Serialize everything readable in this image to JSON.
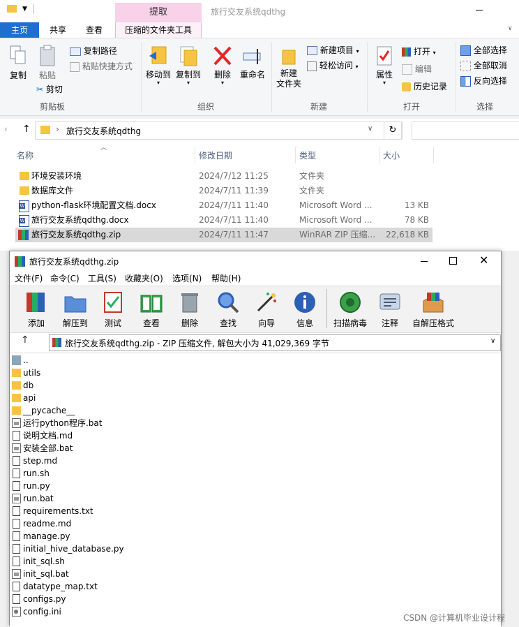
{
  "explorer": {
    "title": "旅行交友系统qdthg",
    "context_tab_top": "提取",
    "tabs": [
      "主页",
      "共享",
      "查看",
      "压缩的文件夹工具"
    ],
    "ribbon": {
      "clipboard": {
        "copy": "复制",
        "paste": "粘贴",
        "copy_path": "复制路径",
        "paste_shortcut": "粘贴快捷方式",
        "cut": "剪切",
        "label": "剪贴板"
      },
      "organize": {
        "move_to": "移动到",
        "copy_to": "复制到",
        "delete": "删除",
        "rename": "重命名",
        "label": "组织"
      },
      "new": {
        "new_folder_line1": "新建",
        "new_folder_line2": "文件夹",
        "new_item": "新建项目",
        "easy_access": "轻松访问",
        "label": "新建"
      },
      "open": {
        "properties": "属性",
        "open": "打开",
        "edit": "编辑",
        "history": "历史记录",
        "label": "打开"
      },
      "select": {
        "select_all": "全部选择",
        "select_none": "全部取消",
        "invert": "反向选择",
        "label": "选择"
      }
    },
    "address": "旅行交友系统qdthg",
    "columns": [
      "名称",
      "修改日期",
      "类型",
      "大小"
    ],
    "files": [
      {
        "name": "环境安装环境",
        "date": "2024/7/12 11:25",
        "type": "文件夹",
        "size": "",
        "icon": "folder-icon"
      },
      {
        "name": "数据库文件",
        "date": "2024/7/11 11:39",
        "type": "文件夹",
        "size": "",
        "icon": "folder-icon"
      },
      {
        "name": "python-flask环境配置文档.docx",
        "date": "2024/7/11 11:40",
        "type": "Microsoft Word ...",
        "size": "13 KB",
        "icon": "word-icon"
      },
      {
        "name": "旅行交友系统qdthg.docx",
        "date": "2024/7/11 11:40",
        "type": "Microsoft Word ...",
        "size": "78 KB",
        "icon": "word-icon"
      },
      {
        "name": "旅行交友系统qdthg.zip",
        "date": "2024/7/11 11:47",
        "type": "WinRAR ZIP 压缩...",
        "size": "22,618 KB",
        "icon": "winrar-icon"
      }
    ]
  },
  "winrar": {
    "title": "旅行交友系统qdthg.zip",
    "menu": [
      "文件(F)",
      "命令(C)",
      "工具(S)",
      "收藏夹(O)",
      "选项(N)",
      "帮助(H)"
    ],
    "toolbar": [
      "添加",
      "解压到",
      "测试",
      "查看",
      "删除",
      "查找",
      "向导",
      "信息",
      "扫描病毒",
      "注释",
      "自解压格式"
    ],
    "path": "旅行交友系统qdthg.zip - ZIP 压缩文件, 解包大小为 41,029,369 字节",
    "items": [
      {
        "name": "..",
        "icon": "parent-folder-icon"
      },
      {
        "name": "utils",
        "icon": "folder-icon"
      },
      {
        "name": "db",
        "icon": "folder-icon"
      },
      {
        "name": "api",
        "icon": "folder-icon"
      },
      {
        "name": "__pycache__",
        "icon": "folder-icon"
      },
      {
        "name": "运行python程序.bat",
        "icon": "bat-icon"
      },
      {
        "name": "说明文档.md",
        "icon": "file-icon"
      },
      {
        "name": "安装全部.bat",
        "icon": "bat-icon"
      },
      {
        "name": "step.md",
        "icon": "file-icon"
      },
      {
        "name": "run.sh",
        "icon": "file-icon"
      },
      {
        "name": "run.py",
        "icon": "file-icon"
      },
      {
        "name": "run.bat",
        "icon": "bat-icon"
      },
      {
        "name": "requirements.txt",
        "icon": "file-icon"
      },
      {
        "name": "readme.md",
        "icon": "file-icon"
      },
      {
        "name": "manage.py",
        "icon": "file-icon"
      },
      {
        "name": "initial_hive_database.py",
        "icon": "file-icon"
      },
      {
        "name": "init_sql.sh",
        "icon": "file-icon"
      },
      {
        "name": "init_sql.bat",
        "icon": "bat-icon"
      },
      {
        "name": "datatype_map.txt",
        "icon": "file-icon"
      },
      {
        "name": "configs.py",
        "icon": "file-icon"
      },
      {
        "name": "config.ini",
        "icon": "ini-icon"
      }
    ]
  },
  "watermark": "CSDN @计算机毕业设计程",
  "colors": {
    "accent": "#1f6fd1",
    "context_tab": "#f7d2e9",
    "selection": "#d9d9d9",
    "folder": "#f6c343"
  }
}
